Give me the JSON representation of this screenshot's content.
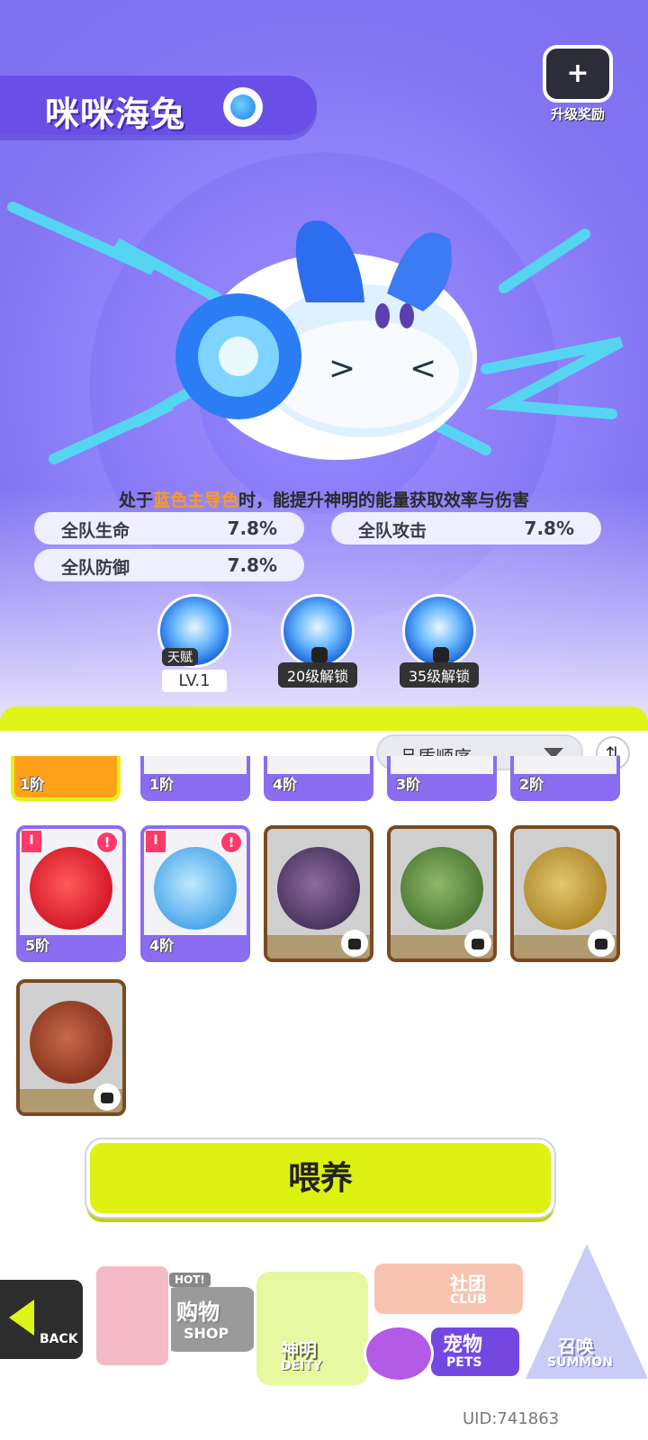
{
  "header": {
    "pet_name": "咪咪海兔",
    "element_icon": "water-element-icon",
    "upgrade_reward_label": "升级奖励"
  },
  "description": {
    "prefix": "处于",
    "highlight": "蓝色主导色",
    "suffix": "时，能提升神明的能量获取效率与伤害"
  },
  "stats": [
    {
      "label": "全队生命",
      "value": "7.8%"
    },
    {
      "label": "全队攻击",
      "value": "7.8%"
    },
    {
      "label": "全队防御",
      "value": "7.8%"
    }
  ],
  "skills": [
    {
      "tag": "天赋",
      "label": "LV.1",
      "locked": false
    },
    {
      "label": "20级解锁",
      "locked": true
    },
    {
      "label": "35级解锁",
      "locked": true
    }
  ],
  "sort": {
    "selected": "品质顺序"
  },
  "partial_cards": [
    "1阶",
    "1阶",
    "4阶",
    "3阶",
    "2阶"
  ],
  "cards": [
    {
      "rank": "5阶",
      "state": "owned",
      "alert": "!",
      "ribbon": "I",
      "pet": "red-shark"
    },
    {
      "rank": "4阶",
      "state": "owned",
      "alert": "!",
      "ribbon": "I",
      "pet": "blue-bird"
    },
    {
      "rank": "",
      "state": "locked",
      "pet": "grape-cat"
    },
    {
      "rank": "",
      "state": "locked",
      "pet": "green-sprout"
    },
    {
      "rank": "",
      "state": "locked",
      "pet": "yellow-puffer"
    },
    {
      "rank": "",
      "state": "locked",
      "pet": "red-octopus"
    }
  ],
  "feed_button": "喂养",
  "nav": {
    "back": "BACK",
    "shop_cn": "购物",
    "shop_en": "SHOP",
    "shop_hot": "HOT!",
    "deity_cn": "神明",
    "deity_en": "DEITY",
    "club_cn": "社团",
    "club_en": "CLUB",
    "pets_cn": "宠物",
    "pets_en": "PETS",
    "summon_cn": "召唤",
    "summon_en": "SUMMON"
  },
  "uid": "UID:741863",
  "colors": {
    "accent_lime": "#dff518",
    "card_purple": "#8a6cf0",
    "card_locked_brown": "#7a4a1e",
    "alert_pink": "#ff3a6a",
    "highlight_orange": "#ff9a1a"
  }
}
